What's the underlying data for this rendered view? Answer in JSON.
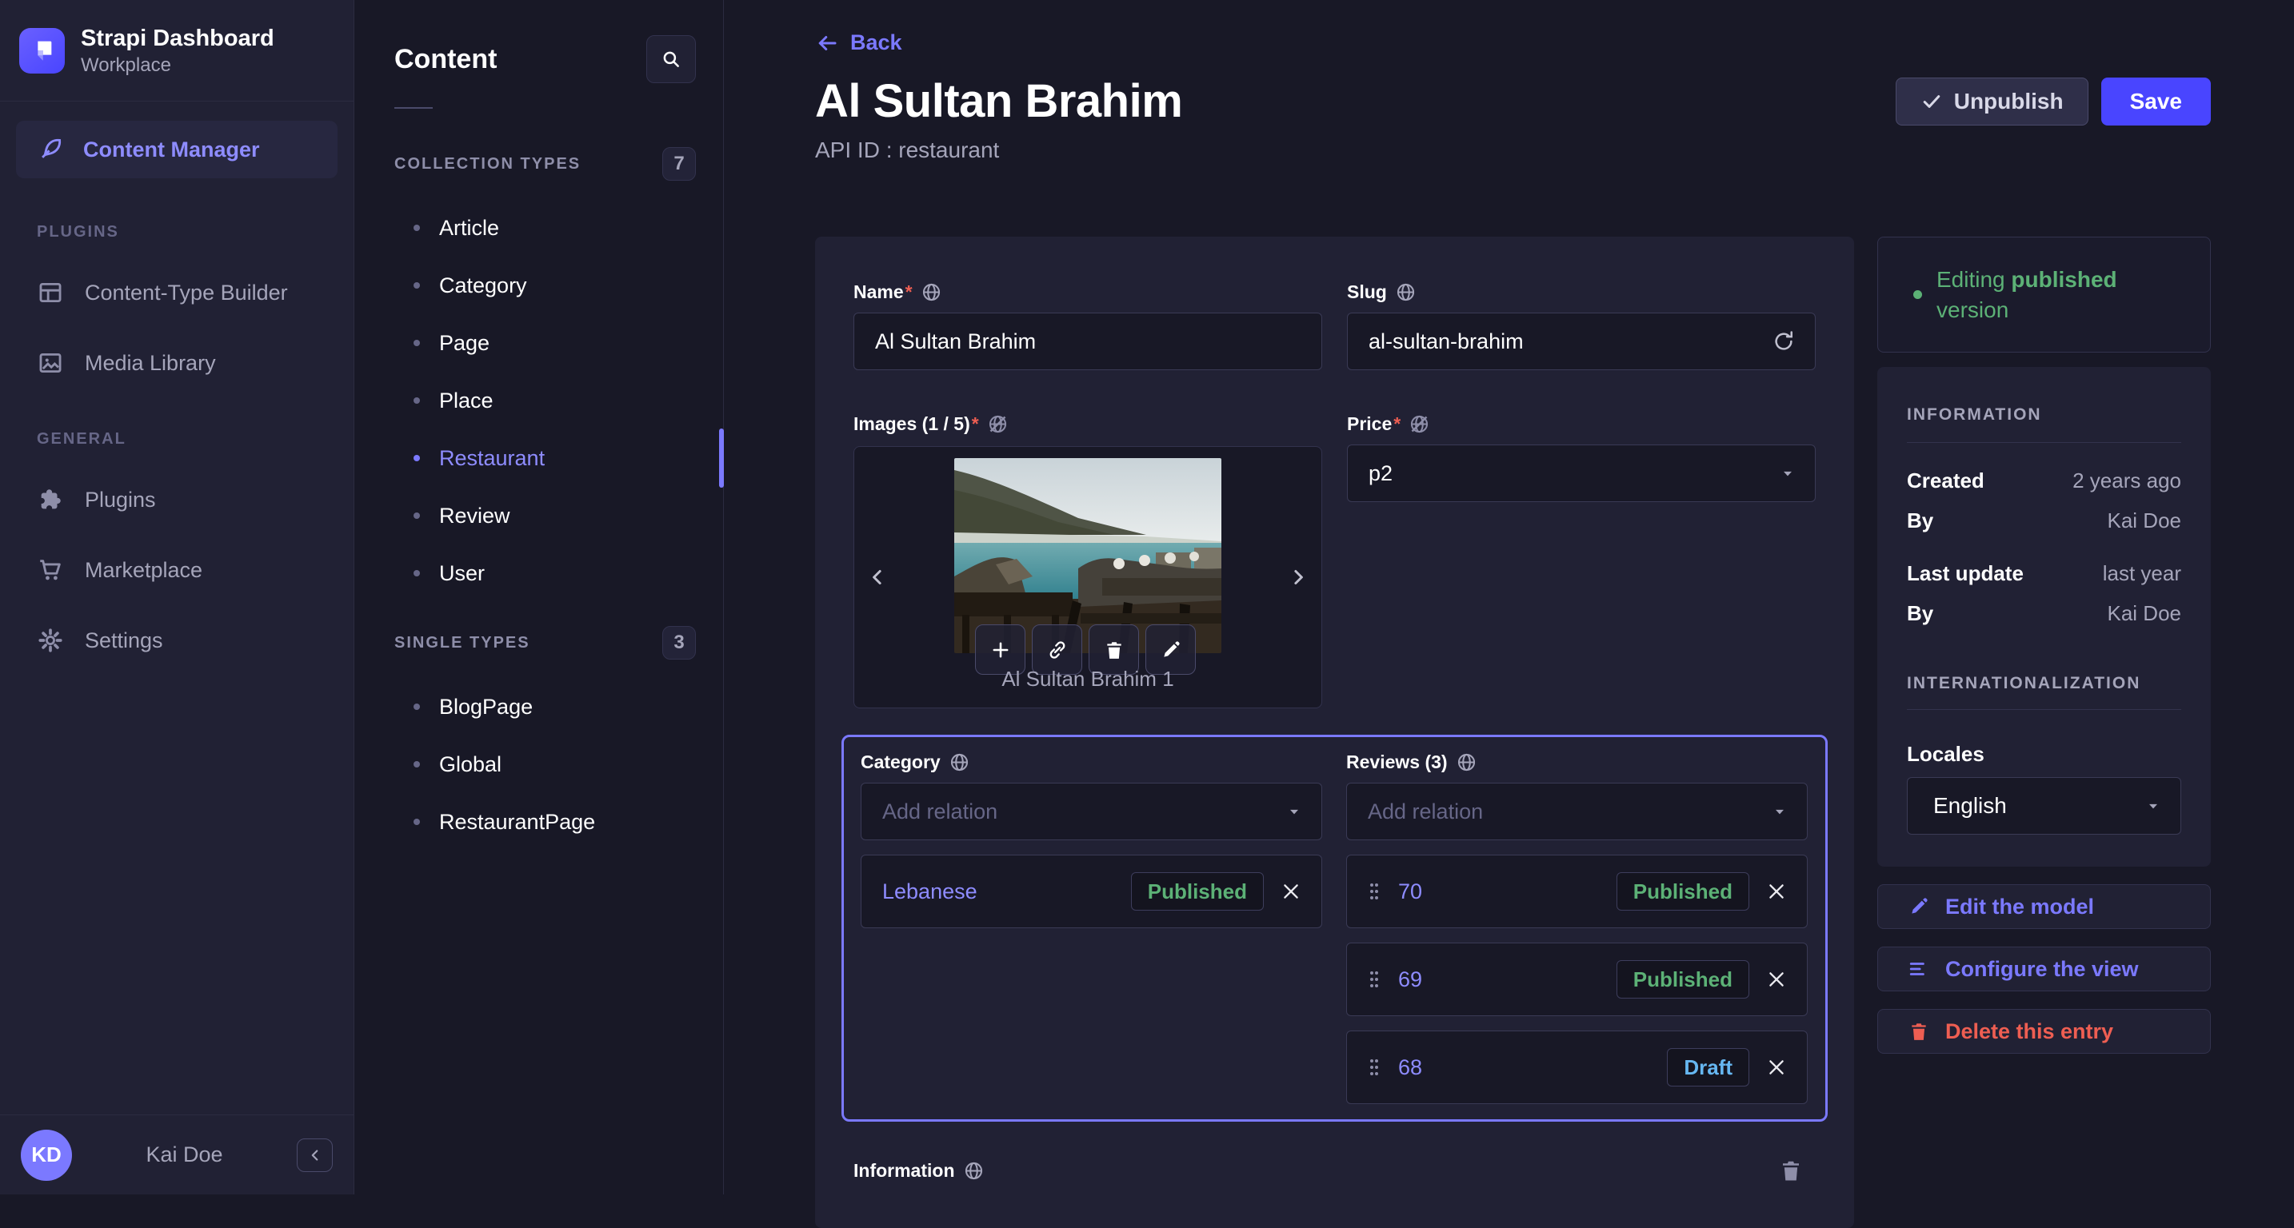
{
  "app": {
    "name": "Strapi Dashboard",
    "workspace": "Workplace"
  },
  "nav": {
    "content_manager": "Content Manager",
    "sections": [
      {
        "label": "PLUGINS",
        "items": [
          {
            "label": "Content-Type Builder"
          },
          {
            "label": "Media Library"
          }
        ]
      },
      {
        "label": "GENERAL",
        "items": [
          {
            "label": "Plugins"
          },
          {
            "label": "Marketplace"
          },
          {
            "label": "Settings"
          }
        ]
      }
    ],
    "user": {
      "initials": "KD",
      "name": "Kai Doe"
    }
  },
  "subnav": {
    "title": "Content",
    "collection_types": {
      "label": "COLLECTION TYPES",
      "count": "7",
      "items": [
        "Article",
        "Category",
        "Page",
        "Place",
        "Restaurant",
        "Review",
        "User"
      ]
    },
    "single_types": {
      "label": "SINGLE TYPES",
      "count": "3",
      "items": [
        "BlogPage",
        "Global",
        "RestaurantPage"
      ]
    }
  },
  "header": {
    "back": "Back",
    "title": "Al Sultan Brahim",
    "api_id": "API ID : restaurant",
    "unpublish": "Unpublish",
    "save": "Save"
  },
  "form": {
    "required_mark": "*",
    "name": {
      "label": "Name",
      "value": "Al Sultan Brahim"
    },
    "slug": {
      "label": "Slug",
      "value": "al-sultan-brahim"
    },
    "images": {
      "label": "Images (1 / 5)",
      "caption": "Al Sultan Brahim 1"
    },
    "price": {
      "label": "Price",
      "value": "p2"
    },
    "category": {
      "label": "Category",
      "placeholder": "Add relation",
      "items": [
        {
          "name": "Lebanese",
          "status": "Published"
        }
      ]
    },
    "reviews": {
      "label": "Reviews (3)",
      "placeholder": "Add relation",
      "items": [
        {
          "name": "70",
          "status": "Published"
        },
        {
          "name": "69",
          "status": "Published"
        },
        {
          "name": "68",
          "status": "Draft"
        }
      ]
    },
    "information": {
      "label": "Information"
    }
  },
  "meta": {
    "editing_prefix": "Editing",
    "editing_bold": "published",
    "editing_suffix": "version",
    "information_title": "INFORMATION",
    "rows": [
      {
        "label": "Created",
        "value": "2 years ago"
      },
      {
        "label": "By",
        "value": "Kai Doe"
      },
      {
        "label": "Last update",
        "value": "last year"
      },
      {
        "label": "By",
        "value": "Kai Doe"
      }
    ],
    "i18n_title": "INTERNATIONALIZATION",
    "locales_label": "Locales",
    "locale_value": "English",
    "actions": [
      {
        "label": "Edit the model"
      },
      {
        "label": "Configure the view"
      },
      {
        "label": "Delete this entry"
      }
    ]
  },
  "colors": {
    "primary": "#4945ff",
    "primary_light": "#7b79ff",
    "success": "#5cb176",
    "danger": "#ee5e52",
    "draft_blue": "#66b7f1"
  }
}
